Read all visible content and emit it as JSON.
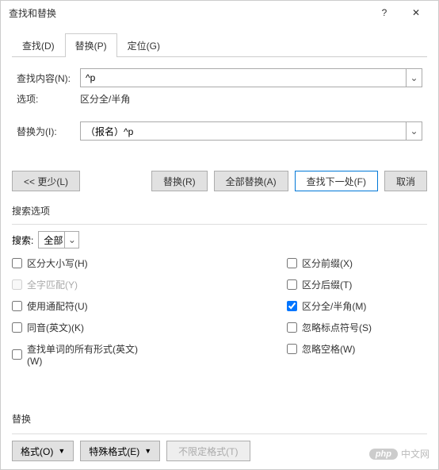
{
  "window": {
    "title": "查找和替换",
    "help_icon": "?",
    "close_icon": "✕"
  },
  "tabs": {
    "find": "查找(D)",
    "replace": "替换(P)",
    "goto": "定位(G)"
  },
  "find": {
    "label": "查找内容(N):",
    "value": "^p"
  },
  "options_row": {
    "label": "选项:",
    "value": "区分全/半角"
  },
  "replace": {
    "label": "替换为(I):",
    "value": "（报名）^p"
  },
  "buttons": {
    "less": "<< 更少(L)",
    "replace": "替换(R)",
    "replace_all": "全部替换(A)",
    "find_next": "查找下一处(F)",
    "cancel": "取消"
  },
  "search_options": {
    "title": "搜索选项",
    "search_label": "搜索:",
    "search_value": "全部",
    "left": {
      "match_case": "区分大小写(H)",
      "whole_word": "全字匹配(Y)",
      "wildcards": "使用通配符(U)",
      "sounds_like": "同音(英文)(K)",
      "word_forms": "查找单词的所有形式(英文)(W)"
    },
    "right": {
      "prefix": "区分前缀(X)",
      "suffix": "区分后缀(T)",
      "full_half": "区分全/半角(M)",
      "ignore_punct": "忽略标点符号(S)",
      "ignore_space": "忽略空格(W)"
    },
    "full_half_checked": true
  },
  "bottom": {
    "section": "替换",
    "format": "格式(O)",
    "special": "特殊格式(E)",
    "no_format": "不限定格式(T)"
  },
  "watermark": {
    "php": "php",
    "text": "中文网"
  }
}
